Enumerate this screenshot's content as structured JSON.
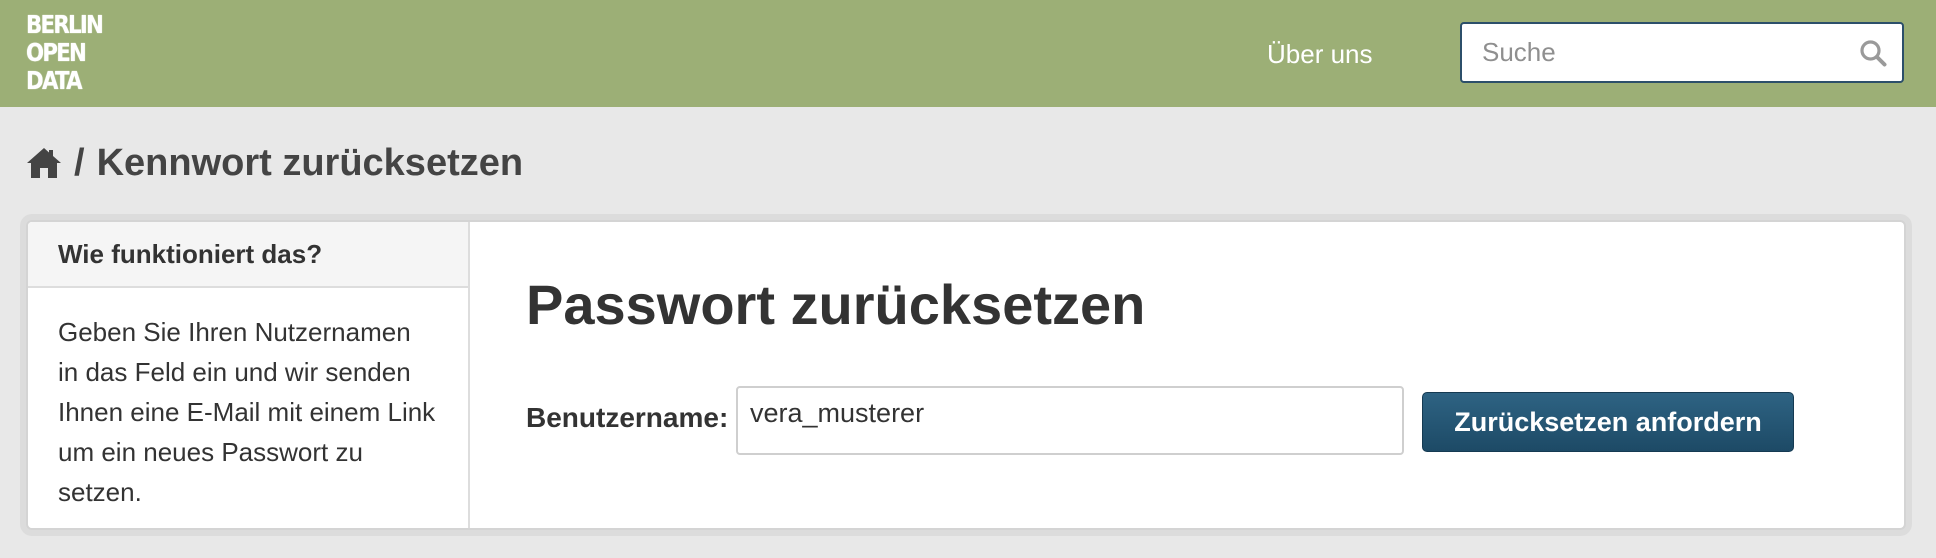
{
  "header": {
    "logo_lines": [
      "BERLIN",
      "OPEN",
      "DATA"
    ],
    "nav_about_label": "Über uns",
    "search_placeholder": "Suche",
    "colors": {
      "bar": "#9caf76",
      "search_border": "#2c4f6a"
    }
  },
  "breadcrumb": {
    "home_icon": "home-icon",
    "separator": "/",
    "current": "Kennwort zurücksetzen"
  },
  "sidebar": {
    "heading": "Wie funktioniert das?",
    "text": "Geben Sie Ihren Nutzernamen in das Feld ein und wir senden Ihnen eine E-Mail mit einem Link um ein neues Passwort zu setzen."
  },
  "form": {
    "title": "Passwort zurücksetzen",
    "username_label": "Benutzername:",
    "username_value": "vera_musterer",
    "submit_label": "Zurücksetzen anfordern",
    "button_color": "#245675"
  }
}
